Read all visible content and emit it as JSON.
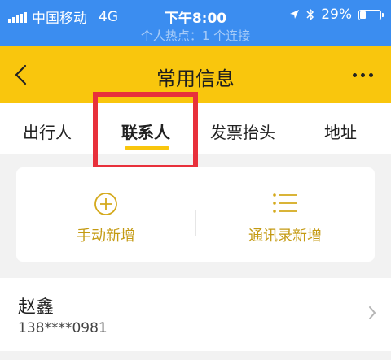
{
  "status_bar": {
    "carrier": "中国移动",
    "network": "4G",
    "time": "下午8:00",
    "battery_percent": "29%",
    "battery_level": 0.29,
    "hotspot": "个人热点：1 个连接"
  },
  "nav": {
    "title": "常用信息"
  },
  "tabs": [
    {
      "label": "出行人",
      "active": false
    },
    {
      "label": "联系人",
      "active": true
    },
    {
      "label": "发票抬头",
      "active": false
    },
    {
      "label": "地址",
      "active": false
    }
  ],
  "actions": {
    "manual_add": "手动新增",
    "contacts_add": "通讯录新增"
  },
  "contacts": [
    {
      "name": "赵鑫",
      "phone": "138****0981"
    }
  ],
  "colors": {
    "status_bar": "#3b8df0",
    "accent_yellow": "#f9c60d",
    "action_gold": "#c49a12",
    "highlight_red": "#e8303b"
  }
}
